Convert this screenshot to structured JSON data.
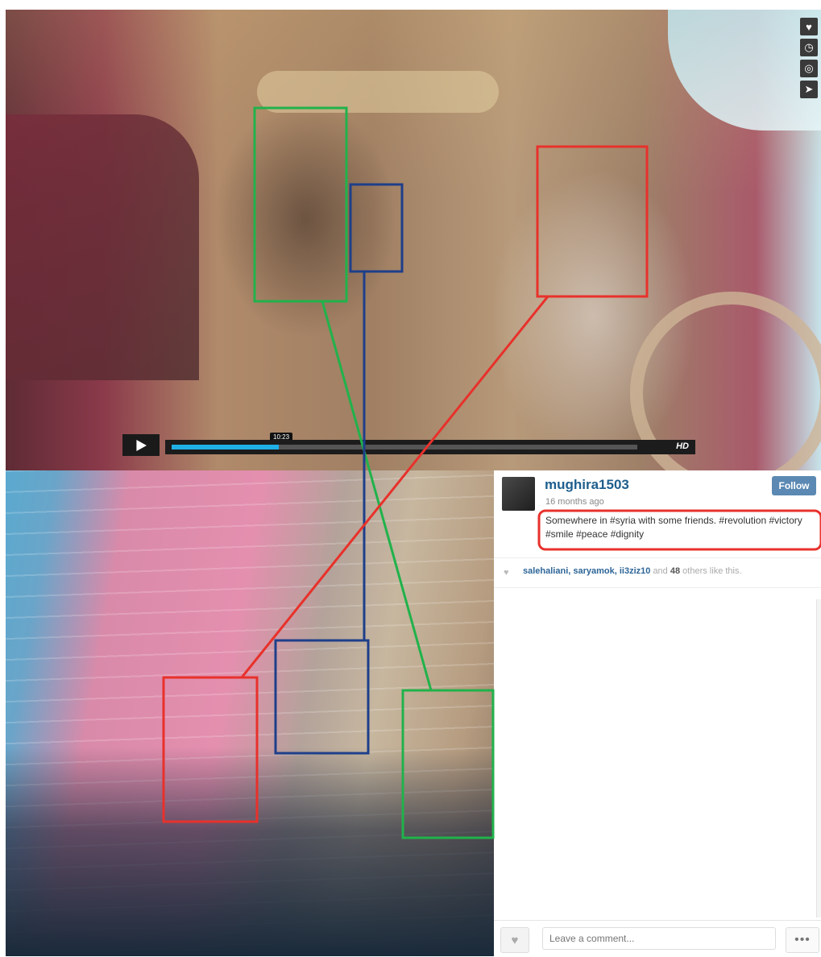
{
  "video": {
    "timestamp": "10:23",
    "progress_fraction": 0.23,
    "hd_label": "HD",
    "side_icons": [
      "heart-icon",
      "clock-icon",
      "layers-icon",
      "send-icon"
    ]
  },
  "post": {
    "username": "mughira1503",
    "time_ago": "16 months ago",
    "follow_label": "Follow",
    "caption": "Somewhere in #syria with some friends. #revolution #victory #smile #peace #dignity",
    "likes": {
      "names": "salehaliani, saryamok, ii3ziz10",
      "and_text": "and",
      "count": "48",
      "suffix": "others like this."
    },
    "comment_placeholder": "Leave a comment...",
    "more_label": "•••"
  },
  "annotations": {
    "colors": {
      "red": "#e8312b",
      "green": "#21b24b",
      "blue": "#1e3f8a"
    }
  }
}
